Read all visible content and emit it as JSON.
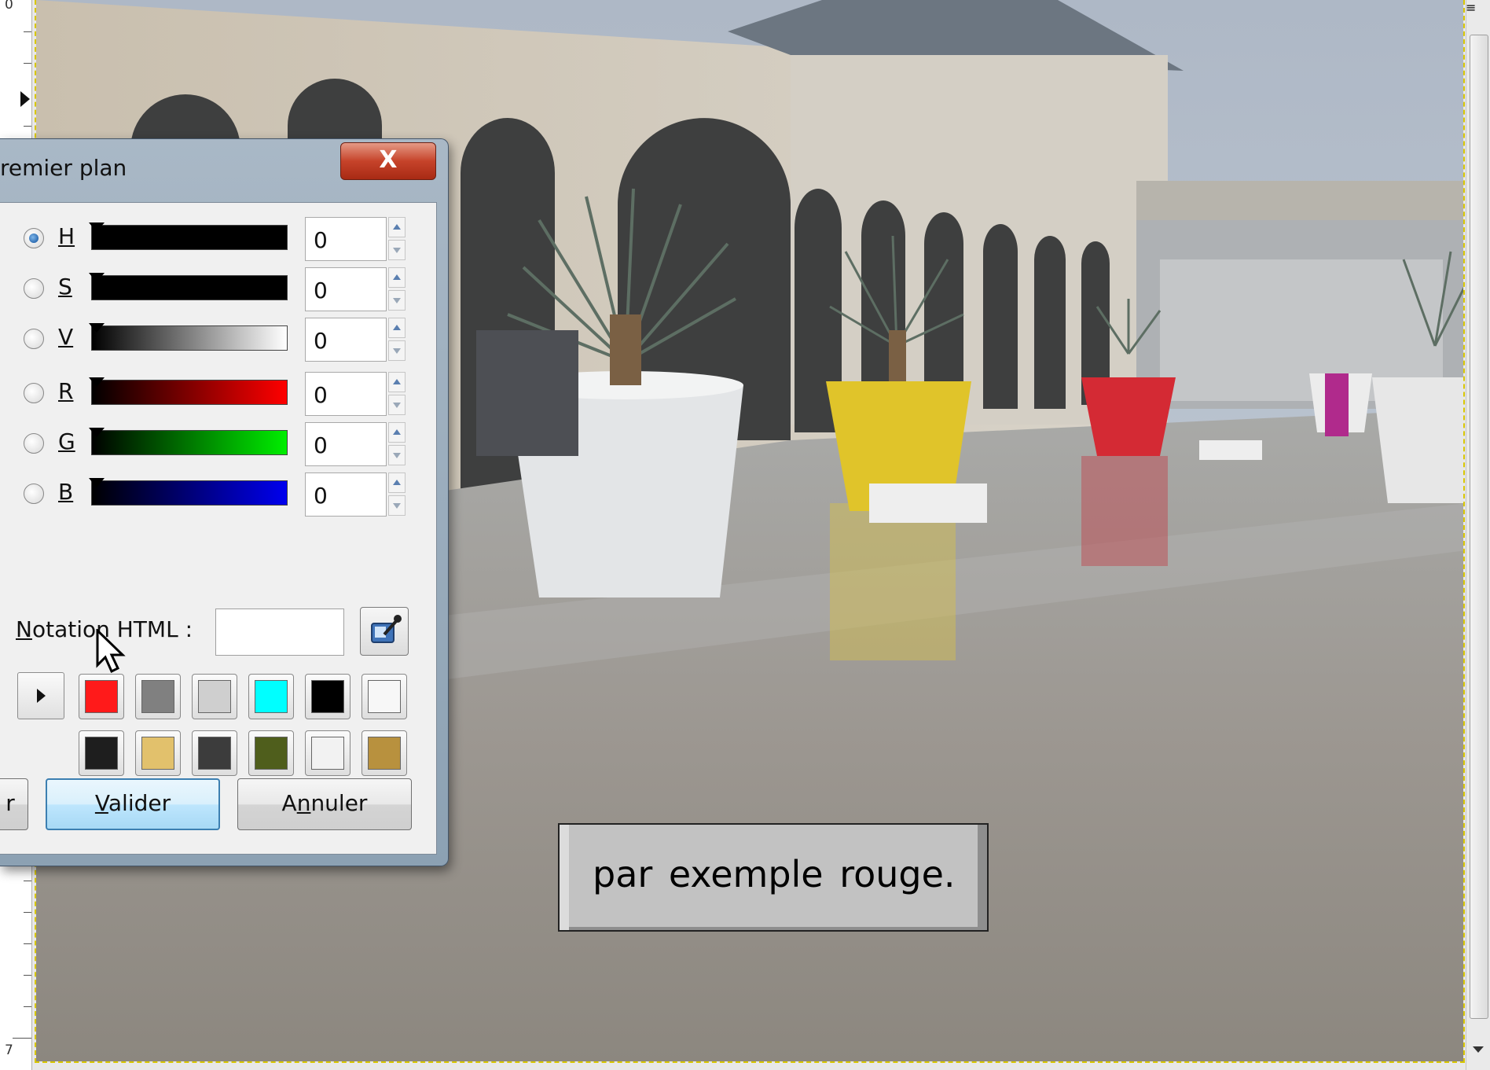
{
  "ruler": {
    "top_label": "0",
    "bottom_label": "7"
  },
  "dialog": {
    "title": "remier plan",
    "close_label": "X",
    "channels": [
      {
        "label": "H",
        "value": "0",
        "checked": true,
        "gradient": "black"
      },
      {
        "label": "S",
        "value": "0",
        "checked": false,
        "gradient": "black"
      },
      {
        "label": "V",
        "value": "0",
        "checked": false,
        "gradient": "black-to-white"
      },
      {
        "label": "R",
        "value": "0",
        "checked": false,
        "gradient": "black-to-red"
      },
      {
        "label": "G",
        "value": "0",
        "checked": false,
        "gradient": "black-to-green"
      },
      {
        "label": "B",
        "value": "0",
        "checked": false,
        "gradient": "black-to-blue"
      }
    ],
    "html_notation": {
      "label": "Notation HTML :",
      "value": ""
    },
    "history_colors_row1": [
      "#ff1a1a",
      "#808080",
      "#cfcfcf",
      "#00ffff",
      "#000000",
      "#f7f7f7"
    ],
    "history_colors_row2": [
      "#1e1e1e",
      "#e2c16c",
      "#3c3c3c",
      "#4f5e1c",
      "#f2f2f2",
      "#b8913e"
    ],
    "ok_label": "Valider",
    "cancel_label": "Annuler",
    "partial_button_label": "r"
  },
  "caption": {
    "text": "par exemple rouge."
  }
}
